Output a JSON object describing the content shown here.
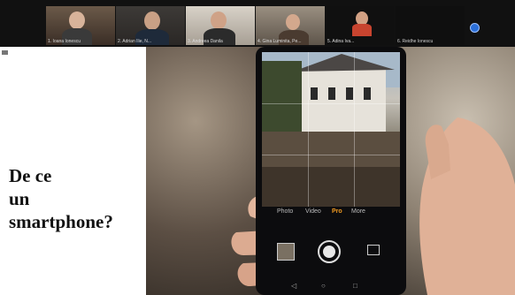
{
  "meeting": {
    "participants": [
      {
        "name": "1. Ioana Ionescu",
        "video": true
      },
      {
        "name": "2. Adrian Ilie, N...",
        "video": true
      },
      {
        "name": "3. Andreea Danila",
        "video": true
      },
      {
        "name": "4. Gina Luminita, Pe...",
        "video": true
      },
      {
        "name": "5. Adina Iva...",
        "video": true
      },
      {
        "name": "6. Reidhe Ionescu",
        "video": false
      }
    ]
  },
  "slide": {
    "title_lines": [
      "De ce",
      "un",
      "smartphone?"
    ]
  },
  "camera_app": {
    "modes": [
      "Photo",
      "Video",
      "Pro",
      "More"
    ],
    "active_mode": "Pro",
    "nav": [
      "◁",
      "○",
      "□"
    ]
  }
}
